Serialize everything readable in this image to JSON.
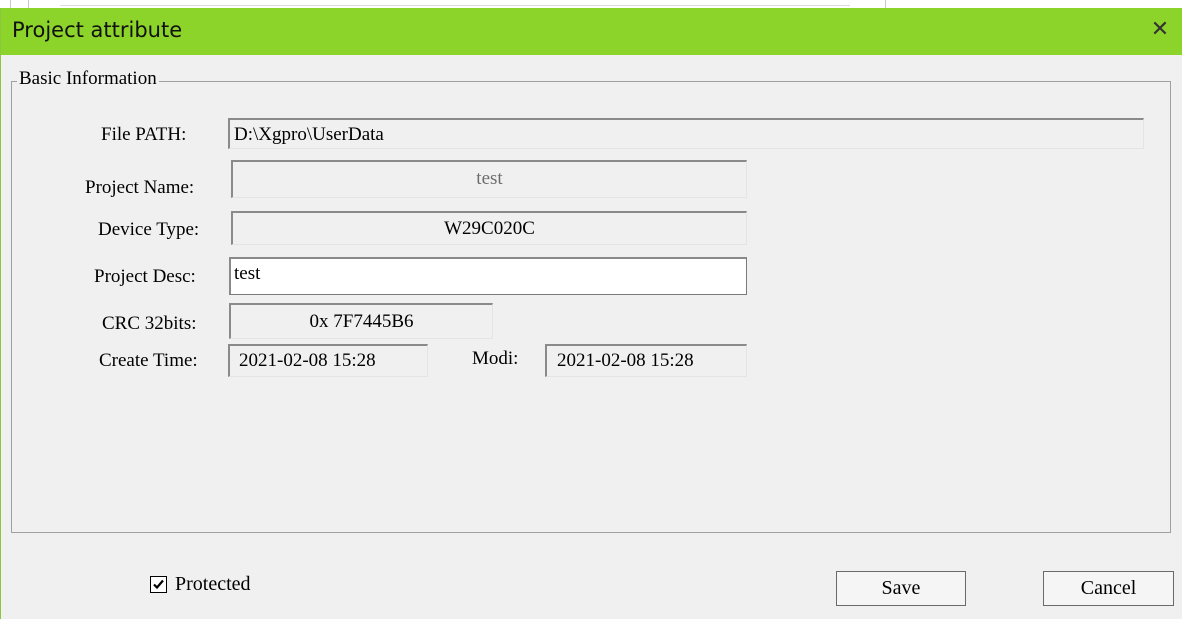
{
  "dialog": {
    "title": "Project attribute",
    "close_glyph": "✕",
    "colors": {
      "titlebar": "#8cd32a",
      "body": "#f0f0f0"
    }
  },
  "group": {
    "legend": "Basic Information"
  },
  "fields": {
    "file_path": {
      "label": "File PATH:",
      "value": "D:\\Xgpro\\UserData"
    },
    "project_name": {
      "label": "Project Name:",
      "value": "test"
    },
    "device_type": {
      "label": "Device Type:",
      "value": "W29C020C"
    },
    "project_desc": {
      "label": "Project Desc:",
      "value": "test"
    },
    "crc": {
      "label": "CRC 32bits:",
      "value": "0x 7F7445B6"
    },
    "create_time": {
      "label": "Create Time:",
      "value": "2021-02-08 15:28"
    },
    "modi_time": {
      "label": "Modi:",
      "value": "2021-02-08 15:28"
    }
  },
  "footer": {
    "protected": {
      "label": "Protected",
      "checked": true
    },
    "save_label": "Save",
    "cancel_label": "Cancel"
  }
}
